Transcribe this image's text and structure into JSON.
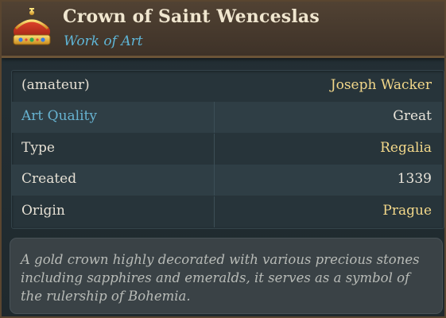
{
  "header": {
    "title": "Crown of Saint Wenceslas",
    "subtitle": "Work of Art",
    "icon": "crown-icon"
  },
  "rows": [
    {
      "key": "(amateur)",
      "value": "Joseph Wacker"
    },
    {
      "key": "Art Quality",
      "value": "Great"
    },
    {
      "key": "Type",
      "value": "Regalia"
    },
    {
      "key": "Created",
      "value": "1339"
    },
    {
      "key": "Origin",
      "value": "Prague"
    }
  ],
  "description": "A gold crown highly decorated with various precious stones including sapphires and emeralds, it serves as a symbol of the rulership of Bohemia.",
  "colors": {
    "header_bg": "#4a3c2f",
    "title": "#f0e6cf",
    "subtitle": "#5fb5d6",
    "gold_value": "#f3d88a",
    "row_alt": "#2f3e45",
    "description_text": "#b8bbb7"
  }
}
